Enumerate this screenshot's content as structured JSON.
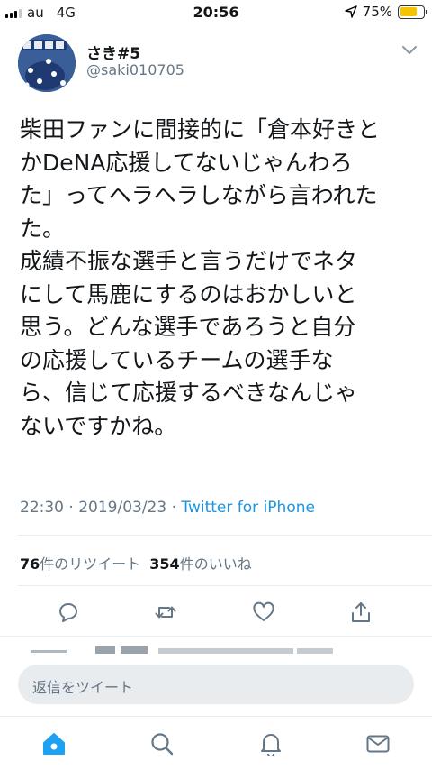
{
  "status_bar": {
    "carrier": "au",
    "network": "4G",
    "time": "20:56",
    "battery_text": "75%",
    "battery_level": 0.75,
    "battery_color": "#f5c400"
  },
  "tweet": {
    "display_name": "さき#5",
    "handle": "@saki010705",
    "text_lines": [
      "柴田ファンに間接的に「倉本好きと",
      "かDeNA応援してないじゃんわろ",
      "た」ってヘラヘラしながら言われた",
      "た。",
      "成績不振な選手と言うだけでネタ",
      "にして馬鹿にするのはおかしいと",
      "思う。どんな選手であろうと自分",
      "の応援しているチームの選手な",
      "ら、信じて応援するべきなんじゃ",
      "ないですかね。"
    ],
    "timestamp": "22:30 · 2019/03/23 · ",
    "source": "Twitter for iPhone",
    "source_color": "#1b95e0",
    "retweets_count": "76",
    "retweets_label": "件のリツイート",
    "likes_count": "354",
    "likes_label": "件のいいね"
  },
  "actions": [
    {
      "icon": "reply-icon"
    },
    {
      "icon": "retweet-icon"
    },
    {
      "icon": "like-icon"
    },
    {
      "icon": "share-icon"
    }
  ],
  "reply_box": {
    "placeholder": "返信をツイート"
  },
  "tabbar": {
    "accent": "#1da1f2",
    "tabs": [
      {
        "icon": "home-icon",
        "active": true
      },
      {
        "icon": "search-icon",
        "active": false
      },
      {
        "icon": "notifications-icon",
        "active": false
      },
      {
        "icon": "messages-icon",
        "active": false
      }
    ]
  }
}
